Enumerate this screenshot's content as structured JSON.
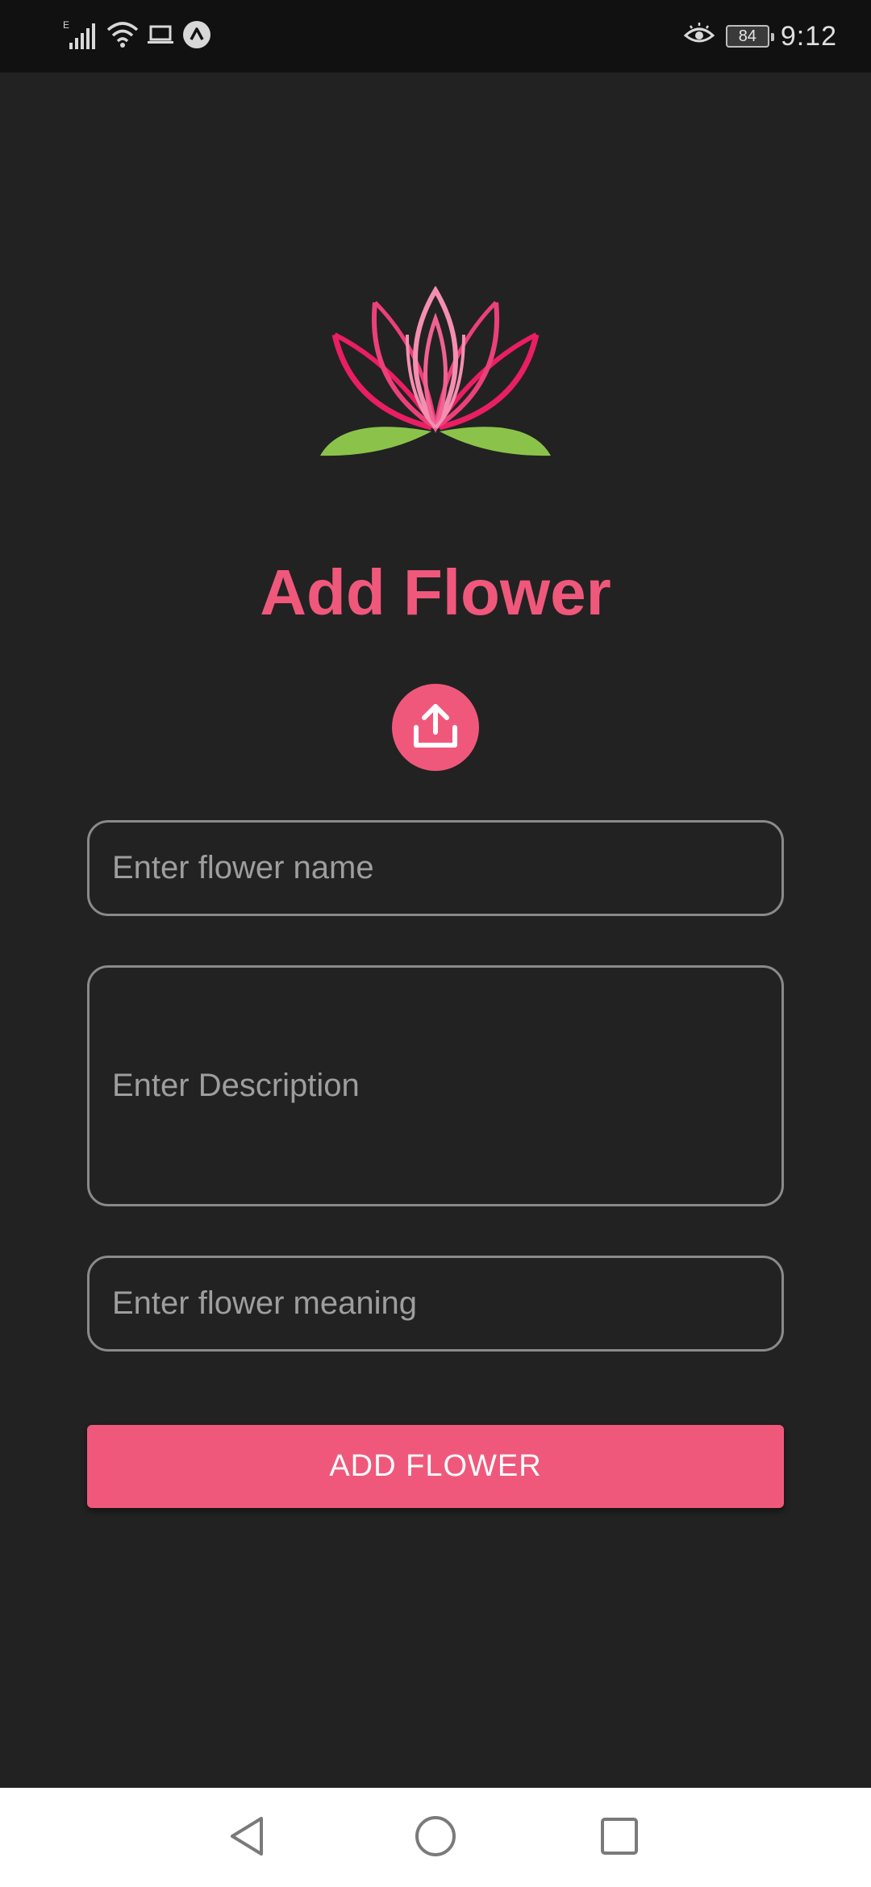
{
  "status_bar": {
    "time": "9:12",
    "battery": "84",
    "network_label": "E",
    "icons": [
      "signal-icon",
      "wifi-icon",
      "laptop-icon",
      "app-notification-icon",
      "eye-comfort-icon",
      "battery-icon"
    ]
  },
  "form": {
    "title": "Add Flower",
    "upload_icon": "upload-icon",
    "name_placeholder": "Enter flower name",
    "description_placeholder": "Enter Description",
    "meaning_placeholder": "Enter flower meaning",
    "submit_label": "ADD FLOWER"
  },
  "colors": {
    "accent": "#f0587b",
    "background": "#222222",
    "leaf": "#8bc34a",
    "petal_dark": "#e91e63",
    "petal_light": "#f48fb1"
  },
  "nav_bar": {
    "icons": [
      "back-icon",
      "home-icon",
      "recents-icon"
    ]
  }
}
